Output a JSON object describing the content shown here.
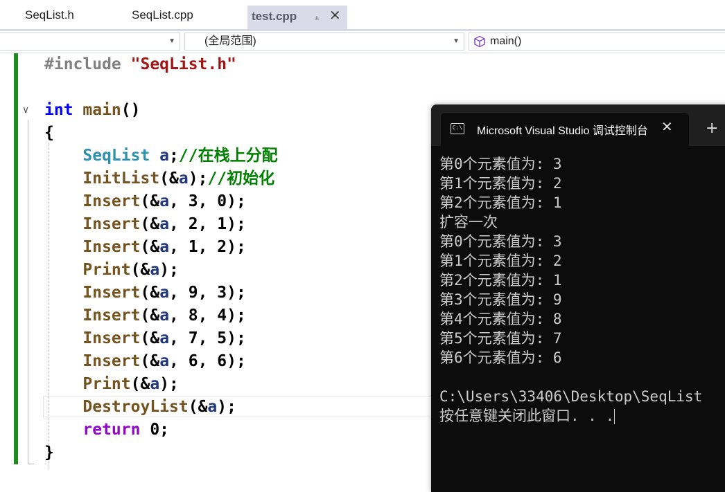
{
  "tabs": [
    {
      "label": "SeqList.h",
      "active": false
    },
    {
      "label": "SeqList.cpp",
      "active": false
    },
    {
      "label": "test.cpp",
      "active": true
    }
  ],
  "tab_pin_icon": "pin-icon",
  "tab_close_glyph": "✕",
  "nav": {
    "project_combo": "",
    "scope_combo": "(全局范围)",
    "member_combo": "main()",
    "member_icon": "cube-icon"
  },
  "editor": {
    "lines": [
      {
        "tokens": [
          [
            "pp",
            "#include "
          ],
          [
            "str",
            "\"SeqList.h\""
          ]
        ]
      },
      {
        "tokens": []
      },
      {
        "tokens": [
          [
            "kw",
            "int "
          ],
          [
            "fn",
            "main"
          ],
          [
            "num",
            "()"
          ]
        ]
      },
      {
        "tokens": [
          [
            "num",
            "{"
          ]
        ]
      },
      {
        "tokens": [
          [
            "num",
            "    "
          ],
          [
            "ty",
            "SeqList "
          ],
          [
            "var",
            "a"
          ],
          [
            "num",
            ";"
          ],
          [
            "cm",
            "//在栈上分配"
          ]
        ]
      },
      {
        "tokens": [
          [
            "num",
            "    "
          ],
          [
            "fn",
            "InitList"
          ],
          [
            "num",
            "(&"
          ],
          [
            "var",
            "a"
          ],
          [
            "num",
            ");"
          ],
          [
            "cm",
            "//初始化"
          ]
        ]
      },
      {
        "tokens": [
          [
            "num",
            "    "
          ],
          [
            "fn",
            "Insert"
          ],
          [
            "num",
            "(&"
          ],
          [
            "var",
            "a"
          ],
          [
            "num",
            ", 3, 0);"
          ]
        ]
      },
      {
        "tokens": [
          [
            "num",
            "    "
          ],
          [
            "fn",
            "Insert"
          ],
          [
            "num",
            "(&"
          ],
          [
            "var",
            "a"
          ],
          [
            "num",
            ", 2, 1);"
          ]
        ]
      },
      {
        "tokens": [
          [
            "num",
            "    "
          ],
          [
            "fn",
            "Insert"
          ],
          [
            "num",
            "(&"
          ],
          [
            "var",
            "a"
          ],
          [
            "num",
            ", 1, 2);"
          ]
        ]
      },
      {
        "tokens": [
          [
            "num",
            "    "
          ],
          [
            "fn",
            "Print"
          ],
          [
            "num",
            "(&"
          ],
          [
            "var",
            "a"
          ],
          [
            "num",
            ");"
          ]
        ]
      },
      {
        "tokens": [
          [
            "num",
            "    "
          ],
          [
            "fn",
            "Insert"
          ],
          [
            "num",
            "(&"
          ],
          [
            "var",
            "a"
          ],
          [
            "num",
            ", 9, 3);"
          ]
        ]
      },
      {
        "tokens": [
          [
            "num",
            "    "
          ],
          [
            "fn",
            "Insert"
          ],
          [
            "num",
            "(&"
          ],
          [
            "var",
            "a"
          ],
          [
            "num",
            ", 8, 4);"
          ]
        ]
      },
      {
        "tokens": [
          [
            "num",
            "    "
          ],
          [
            "fn",
            "Insert"
          ],
          [
            "num",
            "(&"
          ],
          [
            "var",
            "a"
          ],
          [
            "num",
            ", 7, 5);"
          ]
        ]
      },
      {
        "tokens": [
          [
            "num",
            "    "
          ],
          [
            "fn",
            "Insert"
          ],
          [
            "num",
            "(&"
          ],
          [
            "var",
            "a"
          ],
          [
            "num",
            ", 6, 6);"
          ]
        ]
      },
      {
        "tokens": [
          [
            "num",
            "    "
          ],
          [
            "fn",
            "Print"
          ],
          [
            "num",
            "(&"
          ],
          [
            "var",
            "a"
          ],
          [
            "num",
            ");"
          ]
        ]
      },
      {
        "tokens": [
          [
            "num",
            "    "
          ],
          [
            "fn",
            "DestroyList"
          ],
          [
            "num",
            "(&"
          ],
          [
            "var",
            "a"
          ],
          [
            "num",
            ");"
          ]
        ]
      },
      {
        "tokens": [
          [
            "num",
            "    "
          ],
          [
            "ctl",
            "return "
          ],
          [
            "num",
            "0;"
          ]
        ]
      },
      {
        "tokens": [
          [
            "num",
            "}"
          ]
        ]
      }
    ]
  },
  "console": {
    "title": "Microsoft Visual Studio 调试控制台",
    "icon": "terminal-icon",
    "close_glyph": "✕",
    "add_glyph": "+",
    "output": [
      "第0个元素值为: 3",
      "第1个元素值为: 2",
      "第2个元素值为: 1",
      "扩容一次",
      "第0个元素值为: 3",
      "第1个元素值为: 2",
      "第2个元素值为: 1",
      "第3个元素值为: 9",
      "第4个元素值为: 8",
      "第5个元素值为: 7",
      "第6个元素值为: 6",
      "",
      "C:\\Users\\33406\\Desktop\\SeqList",
      "按任意键关闭此窗口. . ."
    ]
  }
}
